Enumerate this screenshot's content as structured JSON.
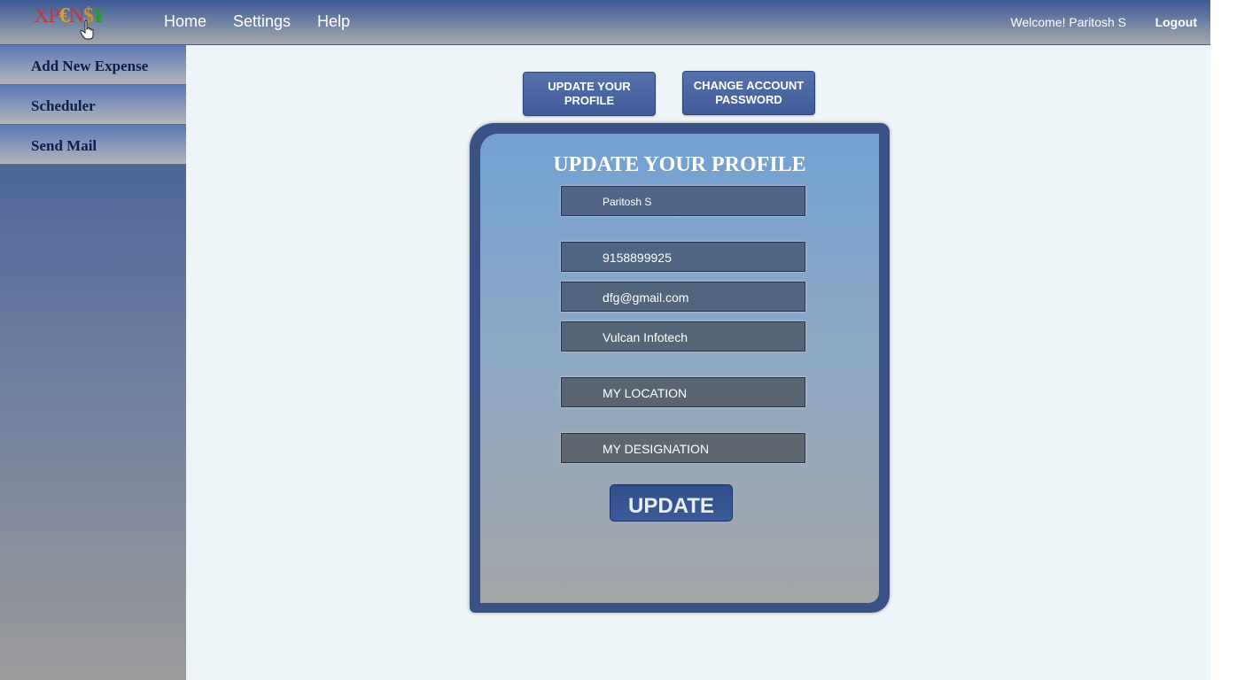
{
  "header": {
    "logo": [
      "X",
      "P",
      "€",
      "N",
      "$",
      "¥"
    ],
    "nav": [
      "Home",
      "Settings",
      "Help"
    ],
    "welcome": "Welcome! Paritosh S",
    "logout": "Logout"
  },
  "sidebar": {
    "items": [
      {
        "label": "Add New Expense"
      },
      {
        "label": "Scheduler"
      },
      {
        "label": "Send Mail"
      }
    ]
  },
  "tabs": {
    "update_profile": [
      "UPDATE YOUR",
      "PROFILE"
    ],
    "change_password": [
      "CHANGE ACCOUNT",
      "PASSWORD"
    ]
  },
  "form": {
    "title": "UPDATE YOUR PROFILE",
    "fields": [
      {
        "value": "Paritosh S"
      },
      {
        "value": "9158899925"
      },
      {
        "value": "dfg@gmail.com"
      },
      {
        "value": "Vulcan Infotech"
      },
      {
        "value": "MY LOCATION"
      },
      {
        "value": "MY DESIGNATION"
      }
    ],
    "submit": "UPDATE"
  },
  "colors": {
    "accent": "#3a5186",
    "page_bg": "#eef5f9"
  }
}
